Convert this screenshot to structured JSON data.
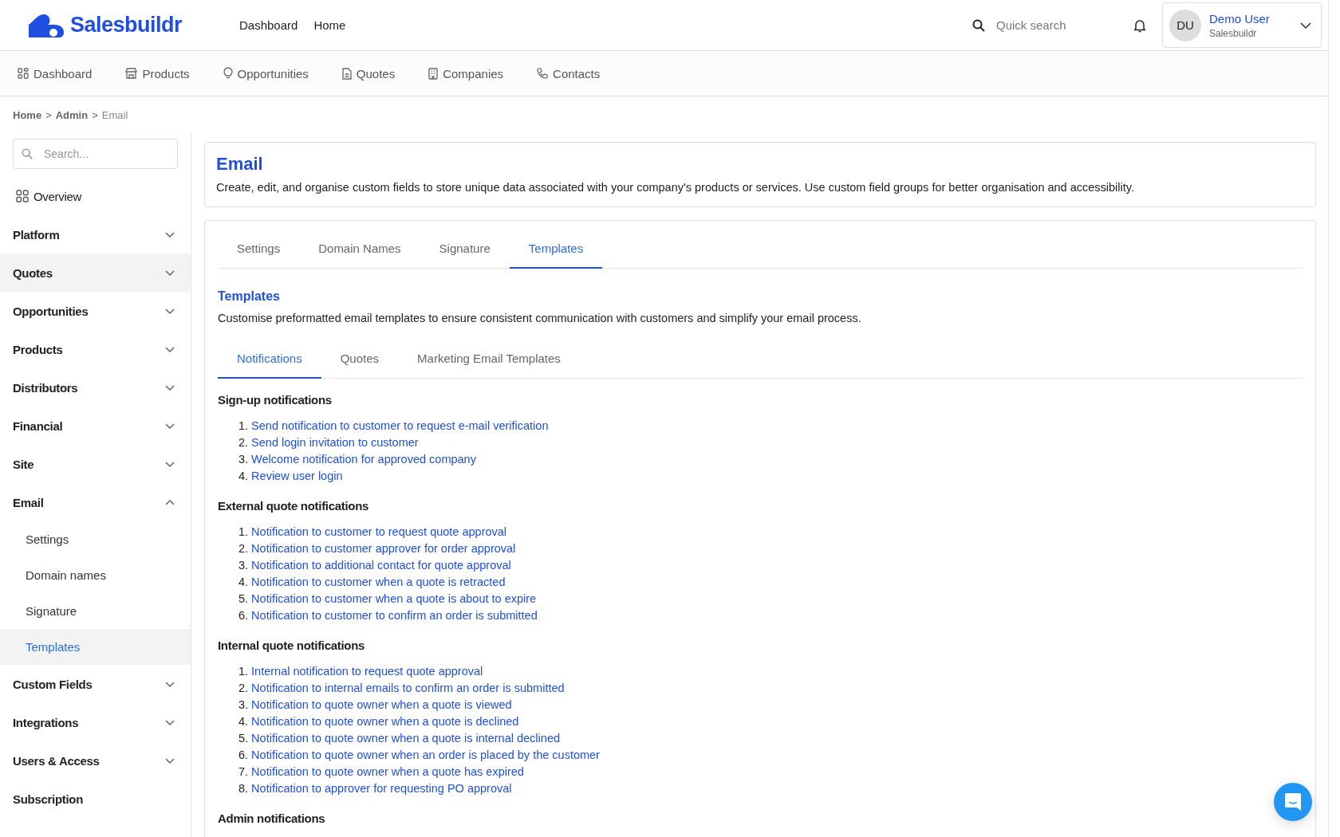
{
  "header": {
    "brand": "Salesbuildr",
    "links": [
      "Dashboard",
      "Home"
    ],
    "search": {
      "placeholder": "Quick search"
    },
    "user": {
      "initials": "DU",
      "name": "Demo User",
      "company": "Salesbuildr"
    }
  },
  "nav": [
    "Dashboard",
    "Products",
    "Opportunities",
    "Quotes",
    "Companies",
    "Contacts"
  ],
  "breadcrumb": [
    {
      "label": "Home",
      "current": false
    },
    {
      "separator": ">",
      "label": "Admin",
      "current": false
    },
    {
      "separator": ">",
      "label": "Email",
      "current": true
    }
  ],
  "sidebar": {
    "search": {
      "placeholder": "Search..."
    },
    "items": [
      {
        "kind": "overview",
        "label": "Overview",
        "highlighted": false
      },
      {
        "kind": "group",
        "label": "Platform",
        "expanded": false,
        "highlighted": false
      },
      {
        "kind": "group",
        "label": "Quotes",
        "expanded": false,
        "highlighted": true
      },
      {
        "kind": "group",
        "label": "Opportunities",
        "expanded": false,
        "highlighted": false
      },
      {
        "kind": "group",
        "label": "Products",
        "expanded": false,
        "highlighted": false
      },
      {
        "kind": "group",
        "label": "Distributors",
        "expanded": false,
        "highlighted": false
      },
      {
        "kind": "group",
        "label": "Financial",
        "expanded": false,
        "highlighted": false
      },
      {
        "kind": "group",
        "label": "Site",
        "expanded": false,
        "highlighted": false
      },
      {
        "kind": "group",
        "label": "Email",
        "expanded": true,
        "highlighted": false,
        "children": [
          {
            "label": "Settings",
            "selected": false
          },
          {
            "label": "Domain names",
            "selected": false
          },
          {
            "label": "Signature",
            "selected": false
          },
          {
            "label": "Templates",
            "selected": true
          }
        ]
      },
      {
        "kind": "group",
        "label": "Custom Fields",
        "expanded": false,
        "highlighted": false
      },
      {
        "kind": "group",
        "label": "Integrations",
        "expanded": false,
        "highlighted": false
      },
      {
        "kind": "group",
        "label": "Users & Access",
        "expanded": false,
        "highlighted": false
      },
      {
        "kind": "plain",
        "label": "Subscription",
        "highlighted": false
      }
    ]
  },
  "page": {
    "title": "Email",
    "description": "Create, edit, and organise custom fields to store unique data associated with your company's products or services. Use custom field groups for better organisation and accessibility."
  },
  "tabs": [
    {
      "label": "Settings",
      "selected": false
    },
    {
      "label": "Domain Names",
      "selected": false
    },
    {
      "label": "Signature",
      "selected": false
    },
    {
      "label": "Templates",
      "selected": true
    }
  ],
  "section": {
    "title": "Templates",
    "description": "Customise preformatted email templates to ensure consistent communication with customers and simplify your email process."
  },
  "subtabs": [
    {
      "label": "Notifications",
      "selected": true
    },
    {
      "label": "Quotes",
      "selected": false
    },
    {
      "label": "Marketing Email Templates",
      "selected": false
    }
  ],
  "groups": [
    {
      "title": "Sign-up notifications",
      "items": [
        {
          "number": "1.",
          "label": "Send notification to customer to request e-mail verification"
        },
        {
          "number": "2.",
          "label": "Send login invitation to customer"
        },
        {
          "number": "3.",
          "label": "Welcome notification for approved company"
        },
        {
          "number": "4.",
          "label": "Review user login"
        }
      ]
    },
    {
      "title": "External quote notifications",
      "items": [
        {
          "number": "1.",
          "label": "Notification to customer to request quote approval"
        },
        {
          "number": "2.",
          "label": "Notification to customer approver for order approval"
        },
        {
          "number": "3.",
          "label": "Notification to additional contact for quote approval"
        },
        {
          "number": "4.",
          "label": "Notification to customer when a quote is retracted"
        },
        {
          "number": "5.",
          "label": "Notification to customer when a quote is about to expire"
        },
        {
          "number": "6.",
          "label": "Notification to customer to confirm an order is submitted"
        }
      ]
    },
    {
      "title": "Internal quote notifications",
      "items": [
        {
          "number": "1.",
          "label": "Internal notification to request quote approval"
        },
        {
          "number": "2.",
          "label": "Notification to internal emails to confirm an order is submitted"
        },
        {
          "number": "3.",
          "label": "Notification to quote owner when a quote is viewed"
        },
        {
          "number": "4.",
          "label": "Notification to quote owner when a quote is declined"
        },
        {
          "number": "5.",
          "label": "Notification to quote owner when a quote is internal declined"
        },
        {
          "number": "6.",
          "label": "Notification to quote owner when an order is placed by the customer"
        },
        {
          "number": "7.",
          "label": "Notification to quote owner when a quote has expired"
        },
        {
          "number": "8.",
          "label": "Notification to approver for requesting PO approval"
        }
      ]
    },
    {
      "title": "Admin notifications"
    }
  ]
}
